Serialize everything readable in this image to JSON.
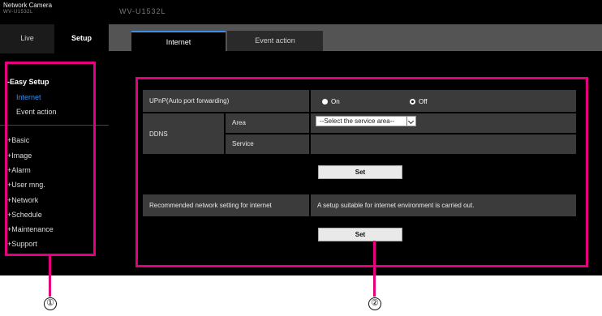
{
  "header": {
    "brand": "Network Camera",
    "brand_sub": "WV-U1532L",
    "model": "WV-U1532L"
  },
  "side_tabs": {
    "live": "Live",
    "setup": "Setup"
  },
  "menu": {
    "easy_setup": "-Easy Setup",
    "internet": "Internet",
    "event_action": "Event action",
    "basic": "+Basic",
    "image": "+Image",
    "alarm": "+Alarm",
    "user_mng": "+User mng.",
    "network": "+Network",
    "schedule": "+Schedule",
    "maintenance": "+Maintenance",
    "support": "+Support"
  },
  "main_tabs": {
    "internet": "Internet",
    "event_action": "Event action"
  },
  "form": {
    "upnp_label": "UPnP(Auto port forwarding)",
    "upnp_on": "On",
    "upnp_off": "Off",
    "upnp_selected": "Off",
    "ddns_label": "DDNS",
    "area_label": "Area",
    "area_value": "--Select the service area--",
    "service_label": "Service",
    "set_label": "Set",
    "recommended_label": "Recommended network setting for internet",
    "recommended_desc": "A setup suitable for internet environment is carried out.",
    "set2_label": "Set"
  },
  "callouts": {
    "one": "①",
    "two": "②"
  },
  "colors": {
    "highlight": "#e6007e",
    "active_link": "#3a8fe8"
  }
}
